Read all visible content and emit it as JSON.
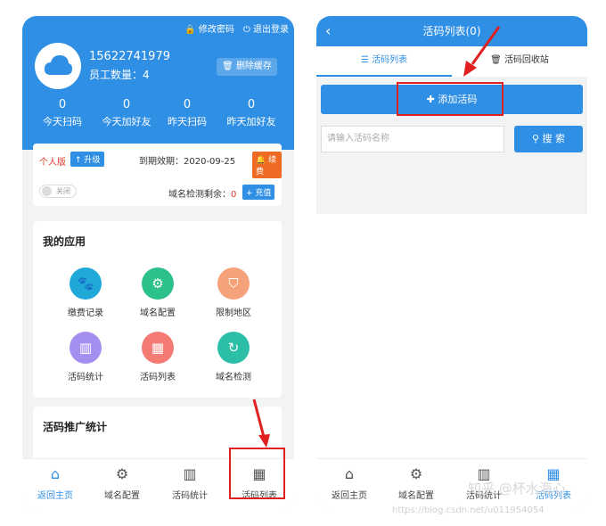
{
  "phone1": {
    "header": {
      "change_password": "修改密码",
      "logout": "退出登录",
      "phone": "15622741979",
      "staff_count": "员工数量：4",
      "clear_cache": "删除缓存",
      "stats": [
        {
          "value": "0",
          "label": "今天扫码"
        },
        {
          "value": "0",
          "label": "今天加好友"
        },
        {
          "value": "0",
          "label": "昨天扫码"
        },
        {
          "value": "0",
          "label": "昨天加好友"
        }
      ]
    },
    "version": {
      "type": "个人版",
      "upgrade": "升级",
      "expire": "到期效期：2020-09-25",
      "renew": "续费",
      "toggle": "关闭",
      "domain_check": "域名检测剩余：",
      "domain_check_value": "0",
      "charge": "充值"
    },
    "apps": {
      "title": "我的应用",
      "items": [
        {
          "label": "缴费记录",
          "icon": "paw-icon",
          "color": "#20a8d8"
        },
        {
          "label": "域名配置",
          "icon": "gear-icon",
          "color": "#2cc08a"
        },
        {
          "label": "限制地区",
          "icon": "shield-icon",
          "color": "#f5a27a"
        },
        {
          "label": "活码统计",
          "icon": "bar-chart-icon",
          "color": "#a48ff0"
        },
        {
          "label": "活码列表",
          "icon": "qrcode-icon",
          "color": "#f47b74"
        },
        {
          "label": "域名检测",
          "icon": "refresh-icon",
          "color": "#2cbfa8"
        }
      ]
    },
    "promo": {
      "title": "活码推广统计"
    },
    "nav": [
      {
        "label": "返回主页",
        "icon": "home-icon"
      },
      {
        "label": "域名配置",
        "icon": "gear-icon"
      },
      {
        "label": "活码统计",
        "icon": "bar-chart-icon"
      },
      {
        "label": "活码列表",
        "icon": "qrcode-icon"
      }
    ]
  },
  "phone2": {
    "title": "活码列表(0)",
    "tabs": [
      {
        "label": "活码列表"
      },
      {
        "label": "活码回收站"
      }
    ],
    "add_button": "添加活码",
    "search_placeholder": "请输入活码名称",
    "search_button": "搜 索",
    "nav": [
      {
        "label": "返回主页",
        "icon": "home-icon"
      },
      {
        "label": "域名配置",
        "icon": "gear-icon"
      },
      {
        "label": "活码统计",
        "icon": "bar-chart-icon"
      },
      {
        "label": "活码列表",
        "icon": "qrcode-icon"
      }
    ]
  },
  "watermark": {
    "main": "知乎 @杯水海心",
    "url": "https://blog.csdn.net/u011954054"
  }
}
